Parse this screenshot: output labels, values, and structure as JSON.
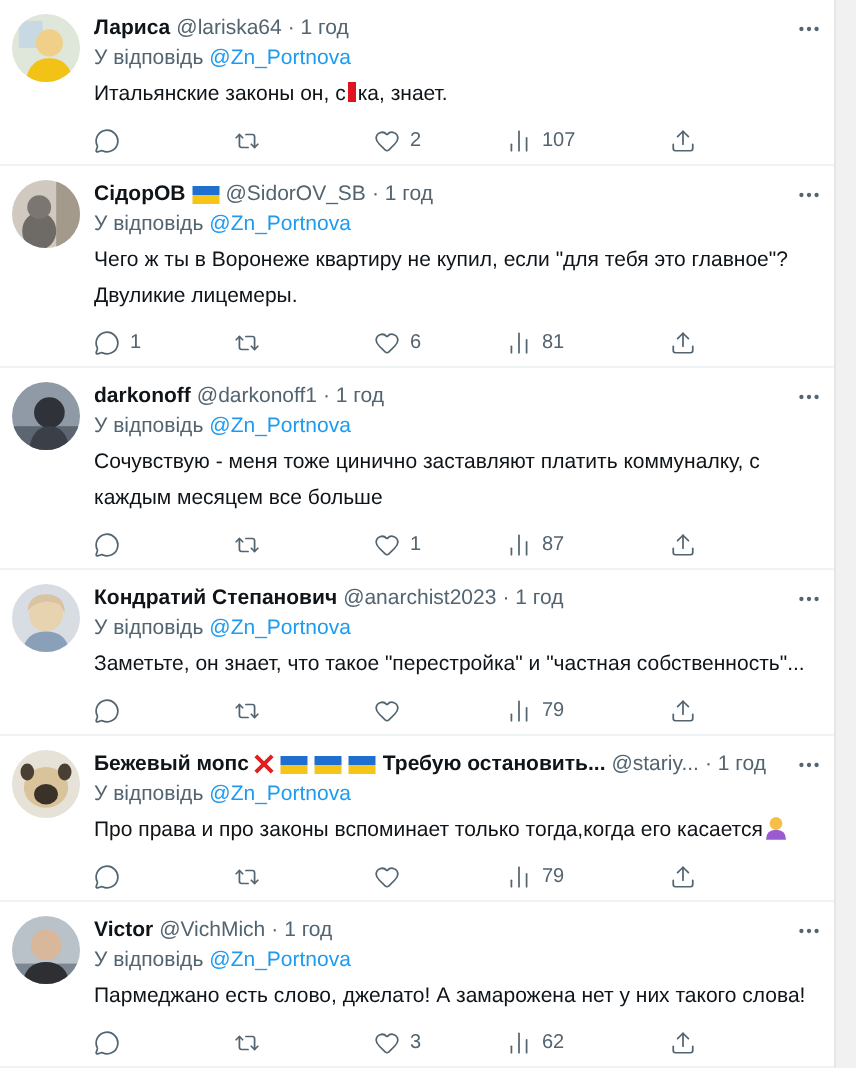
{
  "tweets": [
    {
      "name_parts": [
        {
          "kind": "text",
          "text": "Лариса"
        }
      ],
      "handle": "@lariska64",
      "time": "· 1 год",
      "reply_label": "У відповідь",
      "reply_to": "@Zn_Portnova",
      "segments": [
        {
          "kind": "text",
          "text": "Итальянские законы он, с"
        },
        {
          "kind": "censor"
        },
        {
          "kind": "text",
          "text": "ка, знает."
        }
      ],
      "likes": "2",
      "views": "107"
    },
    {
      "name_parts": [
        {
          "kind": "text",
          "text": "СідорОВ"
        },
        {
          "kind": "flag"
        }
      ],
      "handle": "@SidorOV_SB",
      "time": "· 1 год",
      "reply_label": "У відповідь",
      "reply_to": "@Zn_Portnova",
      "segments": [
        {
          "kind": "text",
          "text": "Чего ж ты в Воронеже квартиру не купил, если \"для тебя это главное\"? Двуликие лицемеры."
        }
      ],
      "replies": "1",
      "likes": "6",
      "views": "81"
    },
    {
      "name_parts": [
        {
          "kind": "text",
          "text": "darkonoff"
        }
      ],
      "handle": "@darkonoff1",
      "time": "· 1 год",
      "reply_label": "У відповідь",
      "reply_to": "@Zn_Portnova",
      "segments": [
        {
          "kind": "text",
          "text": "Сочувствую - меня тоже цинично заставляют платить коммуналку, с каждым месяцем все больше"
        }
      ],
      "likes": "1",
      "views": "87"
    },
    {
      "name_parts": [
        {
          "kind": "text",
          "text": "Кондратий Степанович"
        }
      ],
      "handle": "@anarchist2023",
      "time": "· 1 год",
      "reply_label": "У відповідь",
      "reply_to": "@Zn_Portnova",
      "segments": [
        {
          "kind": "text",
          "text": "Заметьте, он знает, что такое \"перестройка\" и \"частная собственность\"..."
        }
      ],
      "views": "79"
    },
    {
      "name_parts": [
        {
          "kind": "text",
          "text": "Бежевый мопс"
        },
        {
          "kind": "cross"
        },
        {
          "kind": "flag"
        },
        {
          "kind": "flag"
        },
        {
          "kind": "flag"
        },
        {
          "kind": "text",
          "text": "Требую остановить..."
        }
      ],
      "handle": "@stariy...",
      "time": "· 1 год",
      "reply_label": "У відповідь",
      "reply_to": "@Zn_Portnova",
      "segments": [
        {
          "kind": "text",
          "text": "Про права и про законы вспоминает только тогда,когда его касается"
        },
        {
          "kind": "emoji"
        }
      ],
      "views": "79"
    },
    {
      "name_parts": [
        {
          "kind": "text",
          "text": "Victor"
        }
      ],
      "handle": "@VichMich",
      "time": "· 1 год",
      "reply_label": "У відповідь",
      "reply_to": "@Zn_Portnova",
      "segments": [
        {
          "kind": "text",
          "text": "Пармеджано есть слово, джелато! А замарожена нет у них такого слова!"
        }
      ],
      "likes": "3",
      "views": "62"
    }
  ]
}
